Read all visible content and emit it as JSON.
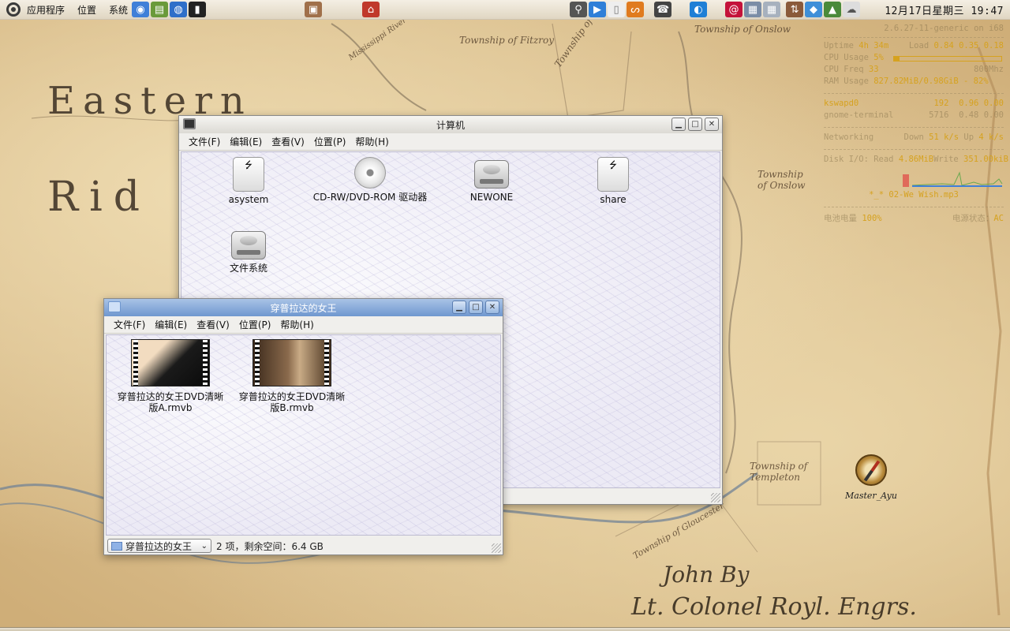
{
  "panel": {
    "menus": [
      "应用程序",
      "位置",
      "系统"
    ],
    "clock": "12月17日星期三 19:47"
  },
  "conky": {
    "host_line": "2.6.27-11-generic on i68",
    "uptime_label": "Uptime",
    "uptime": "4h 34m",
    "load_label": "Load",
    "load": "0.84 0.35 0.18",
    "cpu_label": "CPU Usage",
    "cpu": "5%",
    "cpu_percent": 5,
    "freq_label": "CPU Freq",
    "freq": "33",
    "freq_max": "800Mhz",
    "ram_label": "RAM Usage",
    "ram": "827.82MiB/0.98GiB - 82%",
    "proc1": "kswapd0",
    "proc1_pid": "192",
    "proc1_vals": "0.96   0.00",
    "proc2": "gnome-terminal",
    "proc2_pid": "5716",
    "proc2_vals": "0.48   0.00",
    "net_label": "Networking",
    "net_down_label": "Down",
    "net_down": "51 k/s",
    "net_up_label": "Up",
    "net_up": "4 k/s",
    "disk_label": "Disk I/O: Read",
    "disk_read": "4.86MiB",
    "disk_write_label": "Write",
    "disk_write": "351.00kiB",
    "song": "*_* 02-We Wish.mp3",
    "battery_label": "电池电量",
    "battery": "100%",
    "power_label": "电源状态：",
    "power": "AC"
  },
  "computer_window": {
    "title": "计算机",
    "menu": [
      "文件(F)",
      "编辑(E)",
      "查看(V)",
      "位置(P)",
      "帮助(H)"
    ],
    "items": [
      "asystem",
      "CD-RW/DVD-ROM 驱动器",
      "NEWONE",
      "share",
      "文件系统"
    ]
  },
  "folder_window": {
    "title": "穿普拉达的女王",
    "menu": [
      "文件(F)",
      "编辑(E)",
      "查看(V)",
      "位置(P)",
      "帮助(H)"
    ],
    "files": [
      "穿普拉达的女王DVD清晰版A.rmvb",
      "穿普拉达的女王DVD清晰版B.rmvb"
    ],
    "location": "穿普拉达的女王",
    "status": "2 项，剩余空间：6.4 GB"
  },
  "desktop": {
    "icon_label": "Master_Ayu"
  },
  "map_text": {
    "township_fitzroy": "Township of Fitzroy",
    "township_tarbolton": "Township of Tarbolton",
    "township_onslow_top": "Township of Onslow",
    "township_onslow": "Township of Onslow",
    "township_templeton": "Township of Templeton",
    "township_gloucester": "Township of Gloucester",
    "river": "Mississippi River",
    "eastern": "Eastern",
    "riding": "Rid",
    "signature1": "John By",
    "signature2": "Lt. Colonel Royl. Engrs."
  },
  "colors": {
    "conky_accent": "#d6a21f",
    "folder_titlebar": "#6f97cf"
  }
}
